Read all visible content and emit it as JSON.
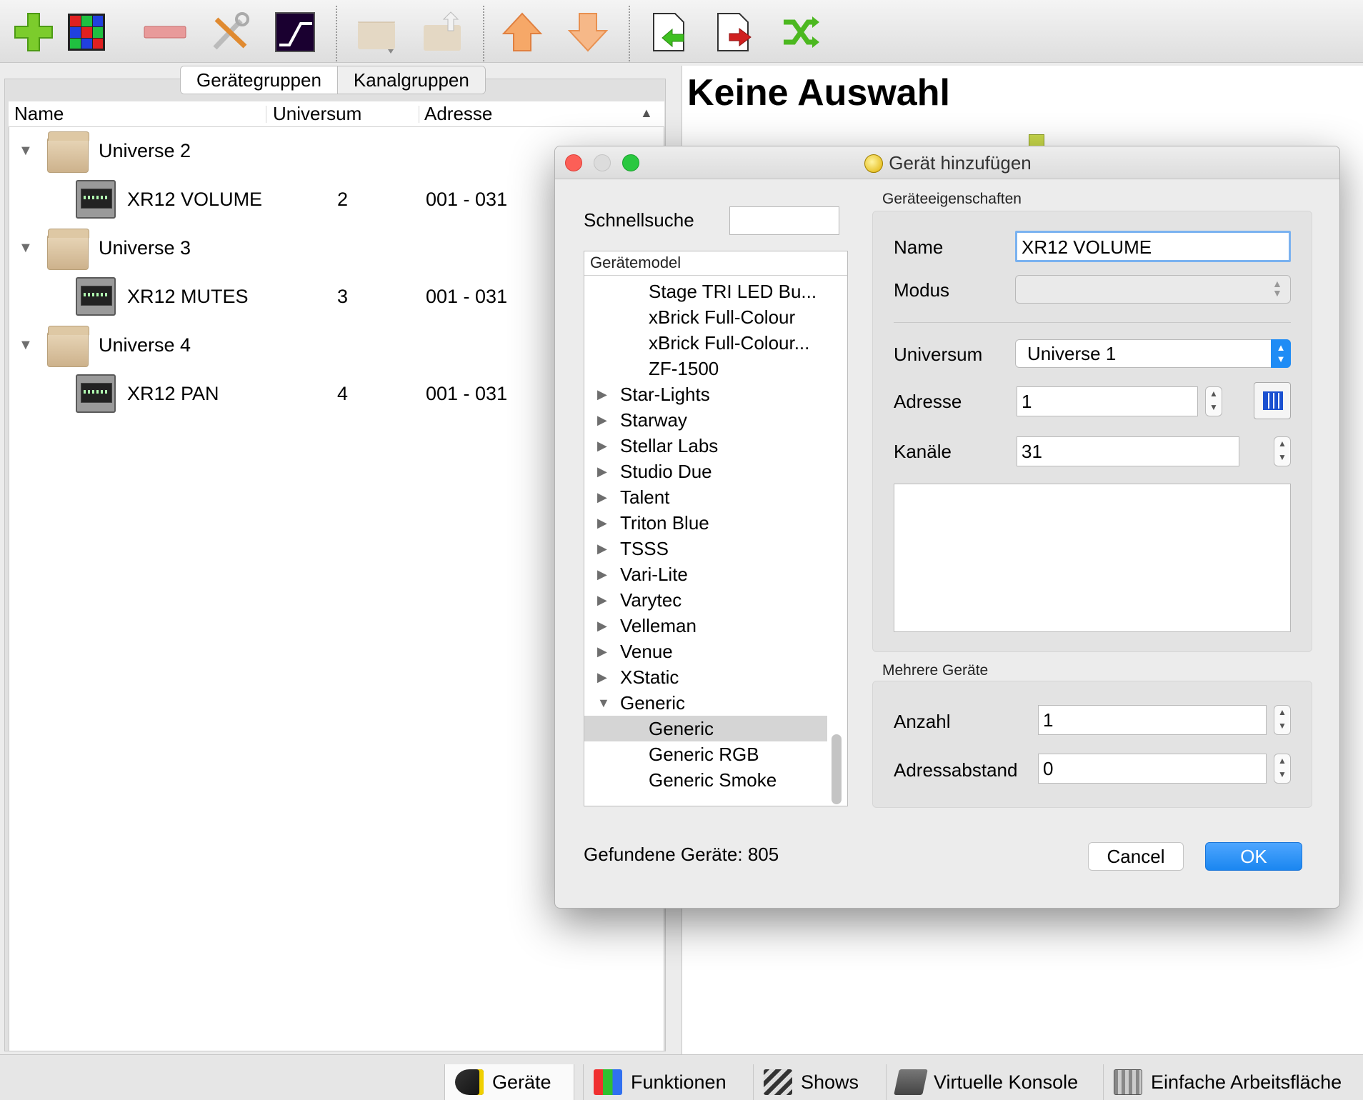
{
  "toolbar": {
    "icons": [
      "add-fixture-icon",
      "rgb-matrix-icon",
      "remove-fixture-icon",
      "properties-tools-icon",
      "channel-modifier-icon",
      "group-folder-icon",
      "export-folder-icon",
      "move-up-icon",
      "move-down-icon",
      "import-icon",
      "export-icon",
      "remap-icon"
    ]
  },
  "tabs": {
    "geraetegruppen": "Gerätegruppen",
    "kanalgruppen": "Kanalgruppen"
  },
  "tree": {
    "columns": {
      "name": "Name",
      "universum": "Universum",
      "adresse": "Adresse"
    },
    "groups": [
      {
        "label": "Universe 2",
        "device": {
          "name": "XR12 VOLUME",
          "universe": "2",
          "address": "001 - 031"
        }
      },
      {
        "label": "Universe 3",
        "device": {
          "name": "XR12 MUTES",
          "universe": "3",
          "address": "001 - 031"
        }
      },
      {
        "label": "Universe 4",
        "device": {
          "name": "XR12 PAN",
          "universe": "4",
          "address": "001 - 031"
        }
      }
    ]
  },
  "right": {
    "title": "Keine Auswahl"
  },
  "dialog": {
    "title": "Gerät hinzufügen",
    "search_label": "Schnellsuche",
    "search_value": "",
    "list_header": "Gerätemodel",
    "list_items": [
      {
        "label": "Stage TRI LED Bu...",
        "level": 2,
        "arrow": ""
      },
      {
        "label": "xBrick Full-Colour",
        "level": 2,
        "arrow": ""
      },
      {
        "label": "xBrick Full-Colour...",
        "level": 2,
        "arrow": ""
      },
      {
        "label": "ZF-1500",
        "level": 2,
        "arrow": ""
      },
      {
        "label": "Star-Lights",
        "level": 1,
        "arrow": "▶"
      },
      {
        "label": "Starway",
        "level": 1,
        "arrow": "▶"
      },
      {
        "label": "Stellar Labs",
        "level": 1,
        "arrow": "▶"
      },
      {
        "label": "Studio Due",
        "level": 1,
        "arrow": "▶"
      },
      {
        "label": "Talent",
        "level": 1,
        "arrow": "▶"
      },
      {
        "label": "Triton Blue",
        "level": 1,
        "arrow": "▶"
      },
      {
        "label": "TSSS",
        "level": 1,
        "arrow": "▶"
      },
      {
        "label": "Vari-Lite",
        "level": 1,
        "arrow": "▶"
      },
      {
        "label": "Varytec",
        "level": 1,
        "arrow": "▶"
      },
      {
        "label": "Velleman",
        "level": 1,
        "arrow": "▶"
      },
      {
        "label": "Venue",
        "level": 1,
        "arrow": "▶"
      },
      {
        "label": "XStatic",
        "level": 1,
        "arrow": "▶"
      },
      {
        "label": "Generic",
        "level": 1,
        "arrow": "▼"
      },
      {
        "label": "Generic",
        "level": 2,
        "arrow": "",
        "selected": true
      },
      {
        "label": "Generic RGB",
        "level": 2,
        "arrow": ""
      },
      {
        "label": "Generic Smoke",
        "level": 2,
        "arrow": ""
      }
    ],
    "props": {
      "group_title": "Geräteeigenschaften",
      "name_label": "Name",
      "name_value": "XR12 VOLUME",
      "modus_label": "Modus",
      "modus_value": "",
      "universum_label": "Universum",
      "universum_value": "Universe 1",
      "adresse_label": "Adresse",
      "adresse_value": "1",
      "kanaele_label": "Kanäle",
      "kanaele_value": "31"
    },
    "multi": {
      "group_title": "Mehrere Geräte",
      "anzahl_label": "Anzahl",
      "anzahl_value": "1",
      "abstand_label": "Adressabstand",
      "abstand_value": "0"
    },
    "found": "Gefundene Geräte: 805",
    "cancel": "Cancel",
    "ok": "OK"
  },
  "bottom_tabs": [
    {
      "label": "Geräte",
      "icon": "spotlight-icon"
    },
    {
      "label": "Funktionen",
      "icon": "function-cubes-icon"
    },
    {
      "label": "Shows",
      "icon": "clapperboard-icon"
    },
    {
      "label": "Virtuelle Konsole",
      "icon": "console-icon"
    },
    {
      "label": "Einfache Arbeitsfläche",
      "icon": "simple-desk-icon"
    }
  ],
  "colors": {
    "accent": "#1f8cf5",
    "selection": "#d5d5d5"
  }
}
